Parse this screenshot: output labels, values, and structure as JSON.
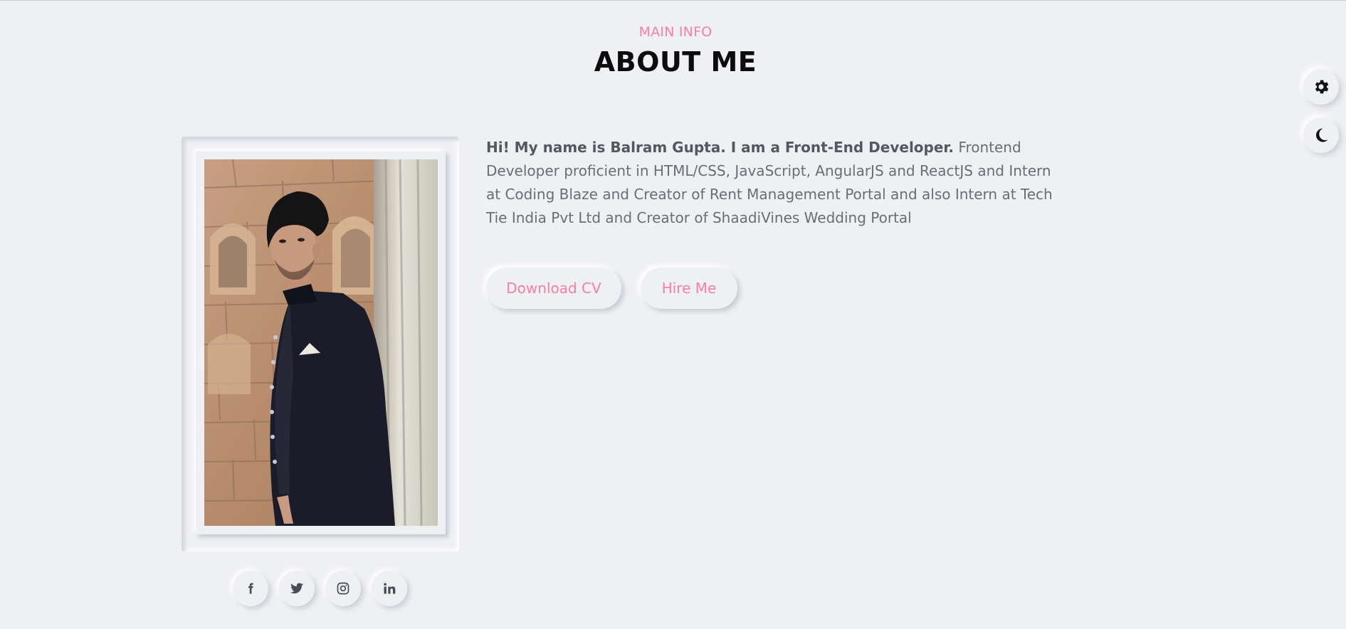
{
  "header": {
    "subtitle": "MAIN INFO",
    "title": "ABOUT ME"
  },
  "floating_controls": {
    "settings_icon": "gear-icon",
    "theme_icon": "moon-icon"
  },
  "profile": {
    "photo_icon": "profile-photo"
  },
  "about": {
    "lead": "Hi! My name is Balram Gupta. I am a Front-End Developer.",
    "body": "Frontend Developer proficient in HTML/CSS, JavaScript, AngularJS and ReactJS and Intern at Coding Blaze and Creator of Rent Management Portal and also Intern at Tech Tie India Pvt Ltd and Creator of ShaadiVines Wedding Portal"
  },
  "actions": {
    "download_cv": "Download CV",
    "hire_me": "Hire Me"
  },
  "social": [
    {
      "icon": "facebook-icon"
    },
    {
      "icon": "twitter-icon"
    },
    {
      "icon": "instagram-icon"
    },
    {
      "icon": "linkedin-icon"
    }
  ],
  "colors": {
    "background": "#eff0f4",
    "accent": "#f5809f",
    "heading": "#0c0c0c",
    "text": "#6b6d74"
  }
}
